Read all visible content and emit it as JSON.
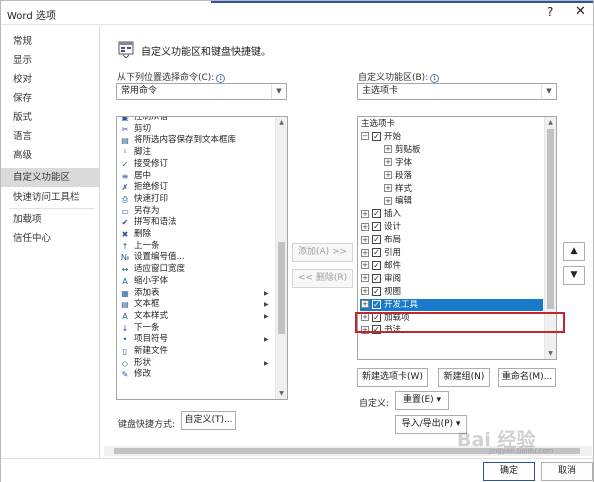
{
  "window": {
    "title": "Word 选项",
    "help_glyph": "?",
    "close_glyph": "✕"
  },
  "nav": {
    "items": [
      "常规",
      "显示",
      "校对",
      "保存",
      "版式",
      "语言",
      "高级",
      "自定义功能区",
      "快速访问工具栏",
      "加载项",
      "信任中心"
    ],
    "active_index": 7
  },
  "header": {
    "text": "自定义功能区和键盘快捷键。",
    "icon": "ribbon-customize-icon"
  },
  "left": {
    "label": "从下列位置选择命令(C):",
    "combo_value": "常用命令",
    "commands": [
      {
        "label": "控制从宿",
        "icon": "box-icon"
      },
      {
        "label": "剪切",
        "icon": "scissors-icon"
      },
      {
        "label": "将所选内容保存到文本框库",
        "icon": "textbox-icon"
      },
      {
        "label": "脚注",
        "icon": "footnote-icon"
      },
      {
        "label": "接受修订",
        "icon": "accept-icon"
      },
      {
        "label": "居中",
        "icon": "align-center-icon"
      },
      {
        "label": "拒绝修订",
        "icon": "reject-icon"
      },
      {
        "label": "快速打印",
        "icon": "print-icon"
      },
      {
        "label": "另存为",
        "icon": "save-as-icon"
      },
      {
        "label": "拼写和语法",
        "icon": "spell-check-icon"
      },
      {
        "label": "删除",
        "icon": "delete-icon"
      },
      {
        "label": "上一条",
        "icon": "previous-icon"
      },
      {
        "label": "设置编号值...",
        "icon": "numbering-icon"
      },
      {
        "label": "适应窗口宽度",
        "icon": "fit-width-icon"
      },
      {
        "label": "缩小字体",
        "icon": "shrink-font-icon"
      },
      {
        "label": "添加表",
        "icon": "table-icon",
        "submenu": true
      },
      {
        "label": "文本框",
        "icon": "textbox-icon",
        "submenu": true
      },
      {
        "label": "文本样式",
        "icon": "text-style-icon",
        "submenu": true
      },
      {
        "label": "下一条",
        "icon": "next-icon"
      },
      {
        "label": "项目符号",
        "icon": "bullets-icon",
        "submenu": true
      },
      {
        "label": "新建文件",
        "icon": "new-file-icon"
      },
      {
        "label": "形状",
        "icon": "shapes-icon",
        "submenu": true
      },
      {
        "label": "修改",
        "icon": "edit-icon"
      }
    ]
  },
  "middle": {
    "add_label": "添加(A) >>",
    "remove_label": "<< 删除(R)"
  },
  "right": {
    "label": "自定义功能区(B):",
    "combo_value": "主选项卡",
    "tree": [
      {
        "label": "主选项卡",
        "level": 0,
        "expander": "",
        "checkbox": false
      },
      {
        "label": "开始",
        "level": 0,
        "expander": "⊟",
        "checkbox": true
      },
      {
        "label": "剪贴板",
        "level": 1,
        "expander": "⊞",
        "checkbox": false
      },
      {
        "label": "字体",
        "level": 1,
        "expander": "⊞",
        "checkbox": false
      },
      {
        "label": "段落",
        "level": 1,
        "expander": "⊞",
        "checkbox": false
      },
      {
        "label": "样式",
        "level": 1,
        "expander": "⊞",
        "checkbox": false
      },
      {
        "label": "编辑",
        "level": 1,
        "expander": "⊞",
        "checkbox": false
      },
      {
        "label": "插入",
        "level": 0,
        "expander": "⊞",
        "checkbox": true
      },
      {
        "label": "设计",
        "level": 0,
        "expander": "⊞",
        "checkbox": true
      },
      {
        "label": "布局",
        "level": 0,
        "expander": "⊞",
        "checkbox": true
      },
      {
        "label": "引用",
        "level": 0,
        "expander": "⊞",
        "checkbox": true
      },
      {
        "label": "邮件",
        "level": 0,
        "expander": "⊞",
        "checkbox": true
      },
      {
        "label": "审阅",
        "level": 0,
        "expander": "⊞",
        "checkbox": true
      },
      {
        "label": "视图",
        "level": 0,
        "expander": "⊞",
        "checkbox": true
      },
      {
        "label": "开发工具",
        "level": 0,
        "expander": "⊞",
        "checkbox": true,
        "selected": true
      },
      {
        "label": "加载项",
        "level": 0,
        "expander": "⊞",
        "checkbox": true
      },
      {
        "label": "书法",
        "level": 0,
        "expander": "⊞",
        "checkbox": true
      }
    ],
    "new_tab_label": "新建选项卡(W)",
    "new_group_label": "新建组(N)",
    "rename_label": "重命名(M)...",
    "customize_label": "自定义:",
    "reset_label": "重置(E) ▾",
    "import_export_label": "导入/导出(P) ▾",
    "move_up_glyph": "▲",
    "move_down_glyph": "▼"
  },
  "shortcuts": {
    "label": "键盘快捷方式:",
    "button_label": "自定义(T)..."
  },
  "footer": {
    "ok_label": "确定",
    "cancel_label": "取消"
  },
  "watermark": {
    "logo_text": "Bai 经验",
    "url": "jingyan.baidu.com"
  },
  "colors": {
    "selection": "#1979ca",
    "highlight_box": "#c1272d",
    "accent": "#2b579a"
  }
}
